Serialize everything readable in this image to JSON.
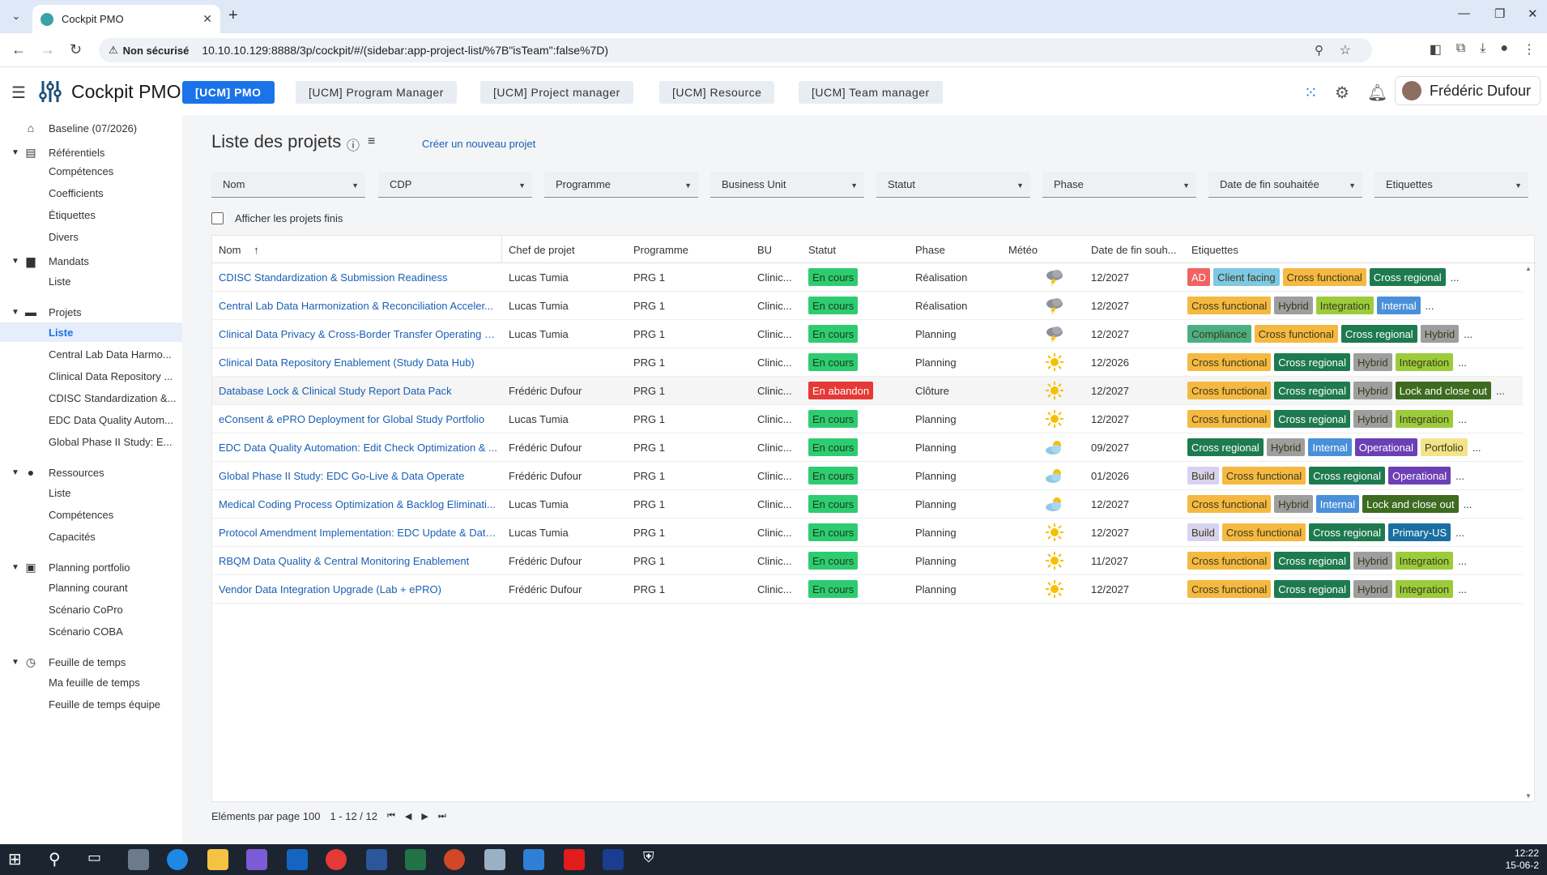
{
  "browser": {
    "tab_title": "Cockpit PMO",
    "security_label": "Non sécurisé",
    "url": "10.10.10.129:8888/3p/cockpit/#/(sidebar:app-project-list/%7B\"isTeam\":false%7D)"
  },
  "app": {
    "title": "Cockpit PMO",
    "roles": [
      {
        "label": "[UCM] PMO",
        "active": true
      },
      {
        "label": "[UCM] Program Manager",
        "active": false
      },
      {
        "label": "[UCM] Project manager",
        "active": false
      },
      {
        "label": "[UCM] Resource",
        "active": false
      },
      {
        "label": "[UCM] Team manager",
        "active": false
      }
    ],
    "user_name": "Frédéric Dufour"
  },
  "sidebar": {
    "baseline": "Baseline (07/2026)",
    "sections": [
      {
        "label": "Référentiels",
        "icon": "list-icon",
        "items": [
          "Compétences",
          "Coefficients",
          "Étiquettes",
          "Divers"
        ]
      },
      {
        "label": "Mandats",
        "icon": "briefcase-icon",
        "items": [
          "Liste"
        ]
      },
      {
        "label": "Projets",
        "icon": "folder-icon",
        "items": [
          "Liste",
          "Central Lab Data Harmo...",
          "Clinical Data Repository ...",
          "CDISC Standardization &...",
          "EDC Data Quality Autom...",
          "Global Phase II Study: E..."
        ]
      },
      {
        "label": "Ressources",
        "icon": "person-icon",
        "items": [
          "Liste",
          "Compétences",
          "Capacités"
        ]
      },
      {
        "label": "Planning portfolio",
        "icon": "calendar-icon",
        "items": [
          "Planning courant",
          "Scénario CoPro",
          "Scénario COBA"
        ]
      },
      {
        "label": "Feuille de temps",
        "icon": "clock-icon",
        "items": [
          "Ma feuille de temps",
          "Feuille de temps équipe"
        ]
      }
    ]
  },
  "page": {
    "title": "Liste des projets",
    "create_link": "Créer un nouveau projet",
    "filters": [
      "Nom",
      "CDP",
      "Programme",
      "Business Unit",
      "Statut",
      "Phase",
      "Date de fin souhaitée",
      "Etiquettes"
    ],
    "show_finished": "Afficher les projets finis",
    "columns": [
      "Nom",
      "Chef de projet",
      "Programme",
      "BU",
      "Statut",
      "Phase",
      "Météo",
      "Date de fin souh...",
      "Etiquettes"
    ],
    "sort_arrow": "↑"
  },
  "status_colors": {
    "En cours": "#2ecc71",
    "En abandon": "#e53935"
  },
  "tag_colors": {
    "AD": "#ef6461",
    "Client facing": "#7ec8e3",
    "Cross functional": "#f5b942",
    "Cross regional": "#1e7a4f",
    "Hybrid": "#9e9e9e",
    "Integration": "#9ccc3c",
    "Internal": "#4a90d9",
    "Compliance": "#4caf82",
    "Lock and close out": "#3d6b1f",
    "Operational": "#6c3fb5",
    "Portfolio": "#f4e38a",
    "Build": "#d8d2f0",
    "Primary-US": "#1a6fa0"
  },
  "rows": [
    {
      "name": "CDISC Standardization & Submission Readiness",
      "pm": "Lucas Tumia",
      "prog": "PRG 1",
      "bu": "Clinic...",
      "status": "En cours",
      "phase": "Réalisation",
      "weather": "storm",
      "date": "12/2027",
      "tags": [
        "AD",
        "Client facing",
        "Cross functional",
        "Cross regional"
      ],
      "more": "..."
    },
    {
      "name": "Central Lab Data Harmonization & Reconciliation Acceler...",
      "pm": "Lucas Tumia",
      "prog": "PRG 1",
      "bu": "Clinic...",
      "status": "En cours",
      "phase": "Réalisation",
      "weather": "storm",
      "date": "12/2027",
      "tags": [
        "Cross functional",
        "Hybrid",
        "Integration",
        "Internal"
      ],
      "more": "..."
    },
    {
      "name": "Clinical Data Privacy & Cross-Border Transfer Operating M...",
      "pm": "Lucas Tumia",
      "prog": "PRG 1",
      "bu": "Clinic...",
      "status": "En cours",
      "phase": "Planning",
      "weather": "storm",
      "date": "12/2027",
      "tags": [
        "Compliance",
        "Cross functional",
        "Cross regional",
        "Hybrid"
      ],
      "more": "..."
    },
    {
      "name": "Clinical Data Repository Enablement (Study Data Hub)",
      "pm": "",
      "prog": "PRG 1",
      "bu": "Clinic...",
      "status": "En cours",
      "phase": "Planning",
      "weather": "sun",
      "date": "12/2026",
      "tags": [
        "Cross functional",
        "Cross regional",
        "Hybrid",
        "Integration"
      ],
      "more": "..."
    },
    {
      "name": "Database Lock & Clinical Study Report Data Pack",
      "pm": "Frédéric Dufour",
      "prog": "PRG 1",
      "bu": "Clinic...",
      "status": "En abandon",
      "phase": "Clôture",
      "weather": "sun",
      "date": "12/2027",
      "tags": [
        "Cross functional",
        "Cross regional",
        "Hybrid",
        "Lock and close out"
      ],
      "more": "...",
      "hover": true
    },
    {
      "name": "eConsent & ePRO Deployment for Global Study Portfolio",
      "pm": "Lucas Tumia",
      "prog": "PRG 1",
      "bu": "Clinic...",
      "status": "En cours",
      "phase": "Planning",
      "weather": "sun",
      "date": "12/2027",
      "tags": [
        "Cross functional",
        "Cross regional",
        "Hybrid",
        "Integration"
      ],
      "more": "..."
    },
    {
      "name": "EDC Data Quality Automation: Edit Check Optimization & ...",
      "pm": "Frédéric Dufour",
      "prog": "PRG 1",
      "bu": "Clinic...",
      "status": "En cours",
      "phase": "Planning",
      "weather": "cloudsun",
      "date": "09/2027",
      "tags": [
        "Cross regional",
        "Hybrid",
        "Internal",
        "Operational",
        "Portfolio"
      ],
      "more": "..."
    },
    {
      "name": "Global Phase II Study: EDC Go-Live & Data Operate",
      "pm": "Frédéric Dufour",
      "prog": "PRG 1",
      "bu": "Clinic...",
      "status": "En cours",
      "phase": "Planning",
      "weather": "cloudsun",
      "date": "01/2026",
      "tags": [
        "Build",
        "Cross functional",
        "Cross regional",
        "Operational"
      ],
      "more": "..."
    },
    {
      "name": "Medical Coding Process Optimization & Backlog Eliminati...",
      "pm": "Lucas Tumia",
      "prog": "PRG 1",
      "bu": "Clinic...",
      "status": "En cours",
      "phase": "Planning",
      "weather": "cloudsun",
      "date": "12/2027",
      "tags": [
        "Cross functional",
        "Hybrid",
        "Internal",
        "Lock and close out"
      ],
      "more": "..."
    },
    {
      "name": "Protocol Amendment Implementation: EDC Update & Data...",
      "pm": "Lucas Tumia",
      "prog": "PRG 1",
      "bu": "Clinic...",
      "status": "En cours",
      "phase": "Planning",
      "weather": "sun",
      "date": "12/2027",
      "tags": [
        "Build",
        "Cross functional",
        "Cross regional",
        "Primary-US"
      ],
      "more": "..."
    },
    {
      "name": "RBQM Data Quality & Central Monitoring Enablement",
      "pm": "Frédéric Dufour",
      "prog": "PRG 1",
      "bu": "Clinic...",
      "status": "En cours",
      "phase": "Planning",
      "weather": "sun",
      "date": "11/2027",
      "tags": [
        "Cross functional",
        "Cross regional",
        "Hybrid",
        "Integration"
      ],
      "more": "..."
    },
    {
      "name": "Vendor Data Integration Upgrade (Lab + ePRO)",
      "pm": "Frédéric Dufour",
      "prog": "PRG 1",
      "bu": "Clinic...",
      "status": "En cours",
      "phase": "Planning",
      "weather": "sun",
      "date": "12/2027",
      "tags": [
        "Cross functional",
        "Cross regional",
        "Hybrid",
        "Integration"
      ],
      "more": "..."
    }
  ],
  "paginator": {
    "label": "Eléments par page",
    "per_page": "100",
    "range": "1 - 12 / 12"
  },
  "taskbar": {
    "time": "12:22",
    "date": "15-06-2"
  }
}
